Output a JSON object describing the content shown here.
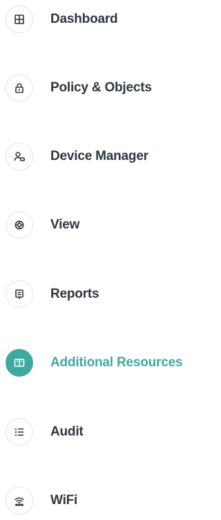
{
  "accent_color": "#3fa9a0",
  "text_color": "#2d3640",
  "nav": {
    "items": [
      {
        "label": "Dashboard",
        "icon": "dashboard-icon",
        "active": false
      },
      {
        "label": "Policy & Objects",
        "icon": "lock-icon",
        "active": false
      },
      {
        "label": "Device Manager",
        "icon": "device-manager-icon",
        "active": false
      },
      {
        "label": "View",
        "icon": "view-icon",
        "active": false
      },
      {
        "label": "Reports",
        "icon": "reports-icon",
        "active": false
      },
      {
        "label": "Additional Resources",
        "icon": "book-icon",
        "active": true
      },
      {
        "label": "Audit",
        "icon": "list-icon",
        "active": false
      },
      {
        "label": "WiFi",
        "icon": "wifi-icon",
        "active": false
      }
    ]
  }
}
